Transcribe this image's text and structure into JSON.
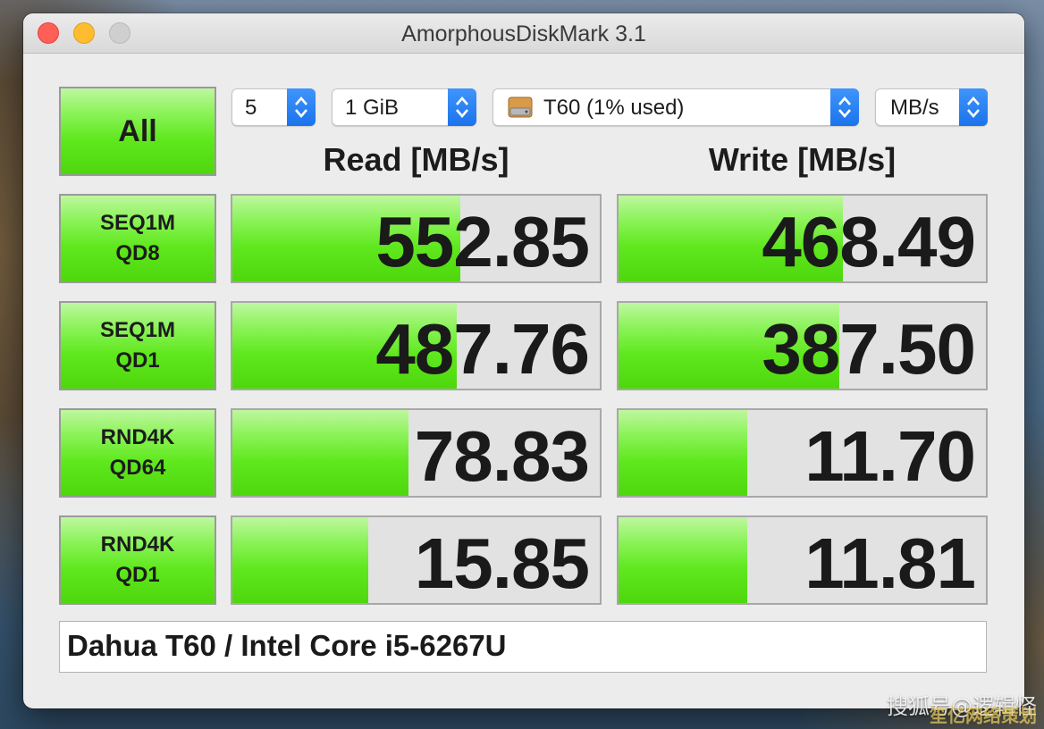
{
  "window": {
    "title": "AmorphousDiskMark 3.1"
  },
  "toolbar": {
    "all_label": "All",
    "count": "5",
    "size": "1 GiB",
    "disk": "T60 (1% used)",
    "unit": "MB/s"
  },
  "columns": {
    "read": "Read [MB/s]",
    "write": "Write [MB/s]"
  },
  "rows": [
    {
      "line1": "SEQ1M",
      "line2": "QD8",
      "read": "552.85",
      "write": "468.49",
      "read_fill": 0.62,
      "write_fill": 0.61
    },
    {
      "line1": "SEQ1M",
      "line2": "QD1",
      "read": "487.76",
      "write": "387.50",
      "read_fill": 0.61,
      "write_fill": 0.6
    },
    {
      "line1": "RND4K",
      "line2": "QD64",
      "read": "78.83",
      "write": "11.70",
      "read_fill": 0.48,
      "write_fill": 0.35
    },
    {
      "line1": "RND4K",
      "line2": "QD1",
      "read": "15.85",
      "write": "11.81",
      "read_fill": 0.37,
      "write_fill": 0.35
    }
  ],
  "comment": "Dahua T60 / Intel Core i5-6267U",
  "watermark": "搜狐号@逻辑怪",
  "watermark2": "笙亿网络策划",
  "colors": {
    "accent": "#1a73ec",
    "meter_green": "#5fe81d"
  }
}
